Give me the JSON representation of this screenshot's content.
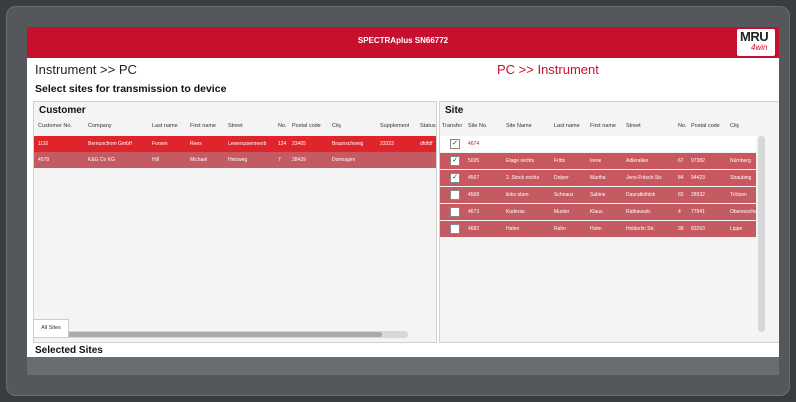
{
  "window": {
    "title": "SPECTRAplus SN66772"
  },
  "logo": {
    "top": "MRU",
    "bottom": "4win"
  },
  "tabs": {
    "left": "Instrument >> PC",
    "right": "PC >> Instrument"
  },
  "subtitle": "Select sites for transmission to device",
  "customer": {
    "title": "Customer",
    "columns": [
      "Customer No.",
      "Company",
      "Last name",
      "First name",
      "Street",
      "No.",
      "Postal code",
      "City",
      "Supplement",
      "Status"
    ],
    "rows": [
      [
        "1110",
        "Bernuncfrom GmbH",
        "Forsen",
        "Rees",
        "Lewerussemeerb",
        "124",
        "23465",
        "Braunschweig",
        "23323",
        "dfdfdf"
      ],
      [
        "4578",
        "K&G Co KG",
        "Hill",
        "Michael",
        "Heizweg",
        "7",
        "28439",
        "Dormagen",
        "",
        ""
      ]
    ]
  },
  "site": {
    "title": "Site",
    "columns": [
      "Transfer",
      "Site No.",
      "Site Name",
      "Last name",
      "First name",
      "Street",
      "No.",
      "Postal code",
      "City"
    ],
    "rows": [
      {
        "check": true,
        "cells": [
          "4674",
          "",
          "",
          "",
          "",
          "",
          "",
          ""
        ]
      },
      {
        "check": true,
        "cells": [
          "5035",
          "Etage rechts",
          "Fritts",
          "Irene",
          "Adlerallee",
          "67",
          "97382",
          "Nürnberg"
        ]
      },
      {
        "check": true,
        "cells": [
          "4567",
          "2. Stock rechts",
          "Dolper",
          "Martha",
          "Jens-Fritsch-Str.",
          "84",
          "94423",
          "Straubing"
        ]
      },
      {
        "check": false,
        "cells": [
          "4568",
          "links oben",
          "Schnaus",
          "Sabine",
          "Dauratköhlsh",
          "65",
          "28932",
          "Trötzen"
        ]
      },
      {
        "check": false,
        "cells": [
          "4673",
          "Kuderas",
          "Muster",
          "Klaus",
          "Rathausstr.",
          "4",
          "77941",
          "Oberessche"
        ]
      },
      {
        "check": false,
        "cells": [
          "4682",
          "Hafen",
          "Rahn",
          "Holm",
          "Holderlin Str.",
          "98",
          "83263",
          "Lippe"
        ]
      }
    ]
  },
  "allsites_tab": "All Sites",
  "selected_title": "Selected Sites",
  "colors": {
    "brand_red": "#c8102e",
    "row_red": "#e0242c"
  }
}
